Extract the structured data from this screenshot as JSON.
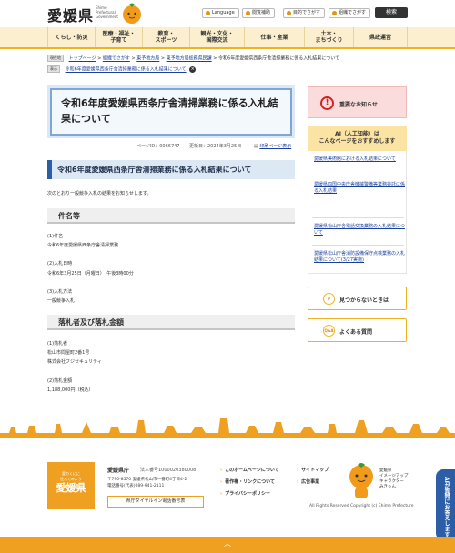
{
  "header": {
    "logo_text": "愛媛県",
    "logo_sub": "Ehime\nPrefectural\nGovernment",
    "buttons": [
      "Language",
      "閲覧補助",
      "目的でさがす",
      "組織でさがす"
    ],
    "search_label": "検索"
  },
  "nav": {
    "items": [
      "くらし・防災",
      "医療・福祉・\n子育て",
      "教育・\nスポーツ",
      "観光・文化・\n国際交流",
      "仕事・産業",
      "土木・\nまちづくり",
      "県政運営"
    ]
  },
  "breadcrumb": {
    "tag1": "現在地",
    "path": [
      "トップページ",
      "組織でさがす",
      "東予地方局",
      "東予地方局総務県民課"
    ],
    "current": "令和6年度愛媛県西条庁舎清掃業務に係る入札結果について",
    "tag2": "表示",
    "shown": "令和6年度愛媛県西条庁舎清掃業務に係る入札結果について",
    "close": "×"
  },
  "main": {
    "title": "令和6年度愛媛県西条庁舎清掃業務に係る入札結果について",
    "page_id": "ページID：0066747",
    "updated": "更新日：2024年3月25日",
    "print": "印刷ページ表示",
    "heading": "令和6年度愛媛県西条庁舎清掃業務に係る入札結果について",
    "intro": "次のとおり一般競争入札の結果をお知らせします。",
    "section1": "件名等",
    "s1_lines": [
      "(1)件名",
      "令和6年度愛媛県西条庁舎清掃業務",
      "",
      "(2)入札日時",
      "令和6年3月25日（月曜日）　午後3時00分",
      "",
      "(3)入札方法",
      "一般競争入札"
    ],
    "section2": "落札者及び落札金額",
    "s2_lines": [
      "(1)落札者",
      "松山市問屋町2番1号",
      "株式会社フジセキュリティ",
      "",
      "(2)落札金額",
      "1,188,000円（税込）"
    ]
  },
  "sidebar": {
    "alert_label": "重要なお知らせ",
    "ai_heading": "AI（人工知能）は\nこんなページをおすすめします",
    "ai_links": [
      "愛媛県美術館における入札結果について",
      "愛媛県四国中央庁舎機械警備等業務委託に係る入札結果",
      "愛媛県松山庁舎電話交換業務の入札結果について",
      "愛媛県松山庁舎消防設備保守点検業務の入札結果について(3/27実施)"
    ],
    "not_found": "見つからないときは",
    "faq": "よくある質問",
    "faq_icon": "Q&A"
  },
  "footer": {
    "logo_small": "愛のくにに\n住んでみよう",
    "logo_big": "愛媛県",
    "name": "愛媛県庁",
    "corp_no": "法人番号1000020380008",
    "address": "〒790-8570 愛媛県松山市一番町4丁目4-2\n電話番号(代表)089-941-2111",
    "dial": "県庁ダイヤルイン電話番号表",
    "links": [
      "このホームページについて",
      "著作権・リンクについて",
      "プライバシーポリシー",
      "サイトマップ",
      "広告事業"
    ],
    "mascot_label": "愛媛県\nイメージアップ\nキャラクター\nみきゃん",
    "copyright": "All Rights Reserved Copyright (c) Ehime Prefecture",
    "ai_fab": "AIが質問にお答えします"
  }
}
